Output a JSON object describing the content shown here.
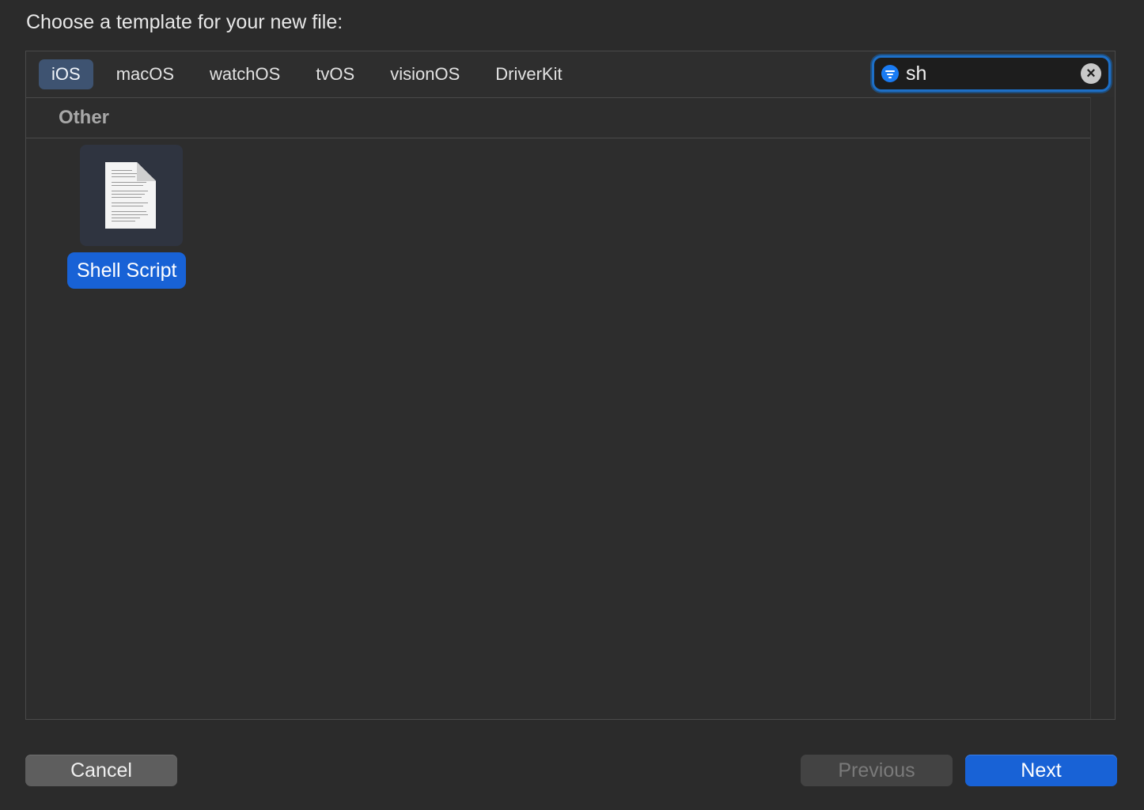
{
  "dialog": {
    "prompt": "Choose a template for your new file:"
  },
  "platform_tabs": [
    {
      "label": "iOS",
      "selected": true
    },
    {
      "label": "macOS",
      "selected": false
    },
    {
      "label": "watchOS",
      "selected": false
    },
    {
      "label": "tvOS",
      "selected": false
    },
    {
      "label": "visionOS",
      "selected": false
    },
    {
      "label": "DriverKit",
      "selected": false
    }
  ],
  "search": {
    "value": "sh",
    "filter_icon": "filter-icon",
    "clear_icon": "clear-icon"
  },
  "section": {
    "title": "Other"
  },
  "templates": [
    {
      "label": "Shell Script",
      "icon": "shell-script-document-icon",
      "selected": true
    }
  ],
  "buttons": {
    "cancel": "Cancel",
    "previous": "Previous",
    "next": "Next"
  },
  "colors": {
    "accent": "#1862d6",
    "background": "#2b2b2b",
    "selected_tab": "#3e5371"
  }
}
